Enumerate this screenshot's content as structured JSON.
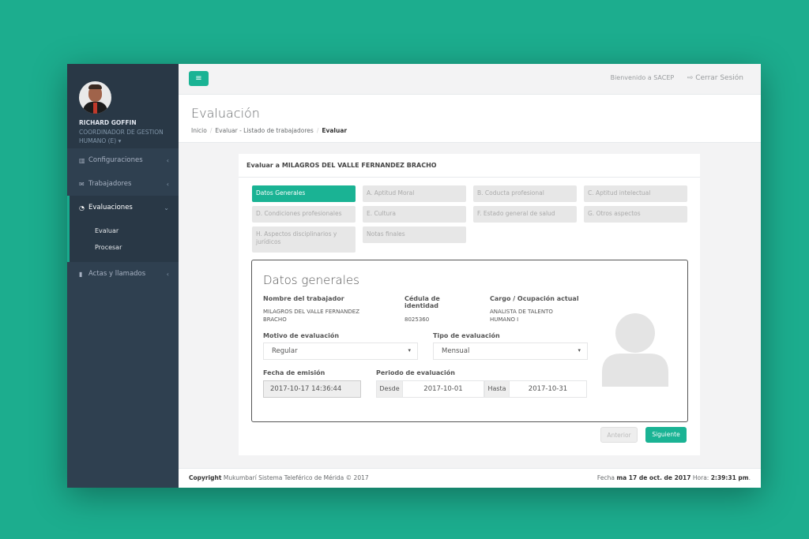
{
  "user": {
    "name": "RICHARD GOFFIN",
    "role": "COORDINADOR DE GESTION HUMANO (E)",
    "caret": "▾"
  },
  "sidebar": {
    "items": [
      {
        "icon": "bar-chart-icon",
        "label": "Configuraciones",
        "chevron": "‹"
      },
      {
        "icon": "envelope-icon",
        "label": "Trabajadores",
        "chevron": "‹"
      },
      {
        "icon": "pie-chart-icon",
        "label": "Evaluaciones",
        "chevron": "⌄"
      },
      {
        "icon": "file-icon",
        "label": "Actas y llamados",
        "chevron": "‹"
      }
    ],
    "submenu": [
      "Evaluar",
      "Procesar"
    ]
  },
  "topbar": {
    "menu_icon": "≡",
    "welcome": "Bienvenido a SACEP",
    "logout": "Cerrar Sesión",
    "logout_icon": "⇨"
  },
  "heading": {
    "title": "Evaluación",
    "crumbs": [
      "Inicio",
      "Evaluar - Listado de trabajadores",
      "Evaluar"
    ],
    "separator": "/"
  },
  "card": {
    "title": "Evaluar a MILAGROS DEL VALLE FERNANDEZ BRACHO",
    "tabs": [
      "Datos Generales",
      "A. Aptitud Moral",
      "B. Coducta profesional",
      "C. Aptitud intelectual",
      "D. Condiciones profesionales",
      "E. Cultura",
      "F. Estado general de salud",
      "G. Otros aspectos",
      "H. Aspectos disciplinarios y jurídicos",
      "Notas finales"
    ],
    "form": {
      "title": "Datos generales",
      "worker_label": "Nombre del trabajador",
      "worker_value": "MILAGROS DEL VALLE FERNANDEZ BRACHO",
      "id_label": "Cédula de identidad",
      "id_value": "8025360",
      "position_label": "Cargo / Ocupación actual",
      "position_value": "ANALISTA DE TALENTO HUMANO I",
      "motive_label": "Motivo de evaluación",
      "motive_value": "Regular",
      "type_label": "Tipo de evaluación",
      "type_value": "Mensual",
      "caret": "▾",
      "emission_label": "Fecha de emisión",
      "emission_value": "2017-10-17 14:36:44",
      "period_label": "Periodo de evaluación",
      "from_label": "Desde",
      "from_value": "2017-10-01",
      "to_label": "Hasta",
      "to_value": "2017-10-31"
    },
    "prev": "Anterior",
    "next": "Siguiente"
  },
  "footer": {
    "copyright_bold": "Copyright",
    "copyright_text": "Mukumbarí Sistema Teleférico de Mérida © 2017",
    "date_prefix": "Fecha",
    "date_value": "ma 17 de oct. de 2017",
    "time_prefix": "Hora:",
    "time_value": "2:39:31 pm",
    "period": "."
  },
  "colors": {
    "accent": "#1ab394",
    "sidebar": "#2f4050",
    "background": "#1cad8e"
  }
}
